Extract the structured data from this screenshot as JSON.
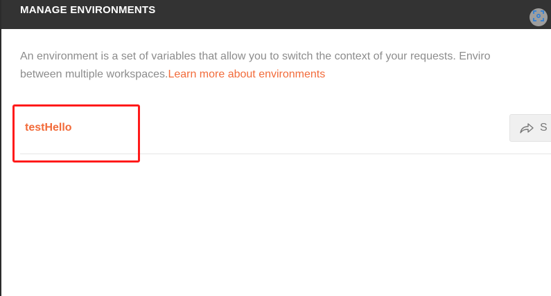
{
  "header": {
    "title": "MANAGE ENVIRONMENTS",
    "capture_icon": "screen-capture-icon"
  },
  "description": {
    "line1": "An environment is a set of variables that allow you to switch the context of your requests. Enviro",
    "line2": "between multiple workspaces.",
    "link_text": "Learn more about environments"
  },
  "environments": [
    {
      "name": "testHello"
    }
  ],
  "actions": {
    "share_label": "S",
    "share_icon": "share-arrow-icon"
  },
  "colors": {
    "accent": "#f26b3a",
    "header_bg": "#333333",
    "highlight": "#ff1a1a",
    "muted_text": "#8c8c8c"
  }
}
